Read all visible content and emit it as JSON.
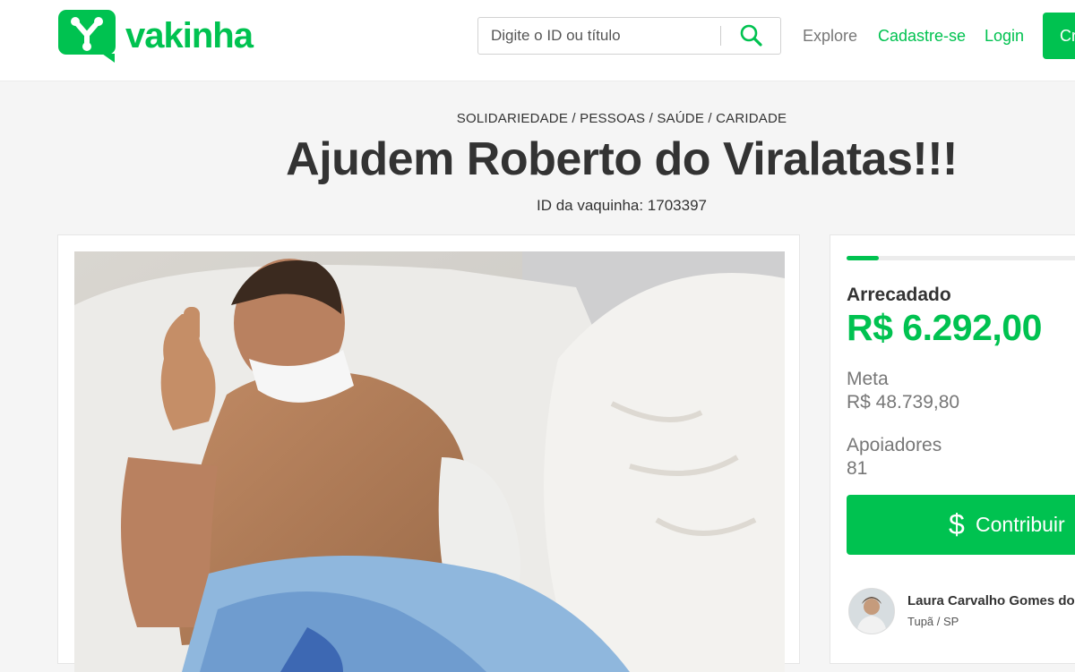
{
  "header": {
    "logo_text": "vakinha",
    "search_placeholder": "Digite o ID ou título",
    "nav": {
      "explore": "Explore",
      "signup": "Cadastre-se",
      "login": "Login",
      "create": "Cr"
    }
  },
  "campaign": {
    "categories": "SOLIDARIEDADE / PESSOAS / SAÚDE / CARIDADE",
    "title": "Ajudem Roberto do Viralatas!!!",
    "id_text": "ID da vaquinha: 1703397"
  },
  "stats": {
    "progress_fraction": 0.129,
    "raised_label": "Arrecadado",
    "raised_value": "R$ 6.292,00",
    "goal_label": "Meta",
    "goal_value": "R$ 48.739,80",
    "backers_label": "Apoiadores",
    "backers_value": "81",
    "contribute_symbol": "$",
    "contribute_label": "Contribuir"
  },
  "donor": {
    "name": "Laura Carvalho Gomes dos",
    "location": "Tupã / SP"
  },
  "colors": {
    "brand_green": "#00c250",
    "text_dark": "#333333",
    "text_muted": "#777777"
  },
  "icons": {
    "logo": "vakinha-logo-icon",
    "search": "search-icon",
    "dollar": "dollar-icon"
  }
}
